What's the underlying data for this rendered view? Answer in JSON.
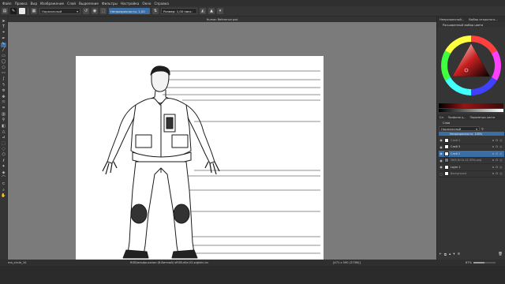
{
  "menu": [
    "Файл",
    "Правка",
    "Вид",
    "Изображение",
    "Слой",
    "Выделение",
    "Фильтры",
    "Настройка",
    "Окно",
    "Справка"
  ],
  "toolbar": {
    "blend_mode": "Нормальный",
    "opacity_label": "Непрозрачность: 1,00",
    "size_label": "Размер: 1,00 пикс.",
    "icons": [
      "new-document-icon",
      "brush-preset-icon",
      "pattern-icon",
      "swap-colors-icon",
      "reset-icon",
      "preserve-alpha-icon",
      "wrap-icon",
      "mirror-icon"
    ]
  },
  "document": {
    "title": "Human Reference.psd"
  },
  "tools": [
    "select-shape-icon",
    "text-icon",
    "edit-shapes-icon",
    "calligraphy-icon",
    "brush-icon",
    "line-icon",
    "rectangle-icon",
    "ellipse-icon",
    "polygon-icon",
    "polyline-icon",
    "bezier-icon",
    "freehand-path-icon",
    "multibrush-icon",
    "move-icon",
    "transform-icon",
    "crop-icon",
    "gradient-icon",
    "color-picker-icon",
    "fill-icon",
    "assistant-icon",
    "measure-icon",
    "rect-select-icon",
    "ellipse-select-icon",
    "polygon-select-icon",
    "freehand-select-icon",
    "contiguous-select-icon",
    "similar-select-icon",
    "bezier-select-icon",
    "magnetic-select-icon",
    "zoom-icon",
    "pan-icon"
  ],
  "dock": {
    "tabs": [
      "Непрозрачный...",
      "Выбор открытого..."
    ],
    "color_panel_title": "Расширенный выбор цвета",
    "lower_tabs": [
      "Сл.",
      "Профили ц...",
      "Параметры кисти"
    ],
    "layers_title": "Слои",
    "blend_mode": "Нормальный",
    "opacity_label": "Непрозрачность: 100%",
    "layers": [
      {
        "name": "Слой 4",
        "dim": true,
        "visible": true,
        "dark_thumb": false,
        "selected": false
      },
      {
        "name": "Слой 3",
        "dim": false,
        "visible": true,
        "dark_thumb": false,
        "selected": false
      },
      {
        "name": "Слой 2",
        "dim": false,
        "visible": true,
        "dark_thumb": false,
        "selected": true
      },
      {
        "name": "2bf4-6c1b-41-9f5b-aeg",
        "dim": true,
        "visible": true,
        "dark_thumb": true,
        "selected": false
      },
      {
        "name": "Layer 1",
        "dim": false,
        "visible": true,
        "dark_thumb": false,
        "selected": false
      },
      {
        "name": "Background",
        "dim": true,
        "visible": false,
        "dark_thumb": false,
        "selected": false
      }
    ]
  },
  "status": {
    "brush": "ma_circle_10",
    "color_info": "RGB/альфа-канал (8-битный) sRGB-elle-V2-srgbtrc.icc",
    "dimensions": "[471 x 590 (273М)]",
    "zoom": "67%"
  },
  "colors": {
    "accent": "#3b6ea5",
    "canvas_bg": "#7b7b7b",
    "panel_bg": "#353535"
  }
}
